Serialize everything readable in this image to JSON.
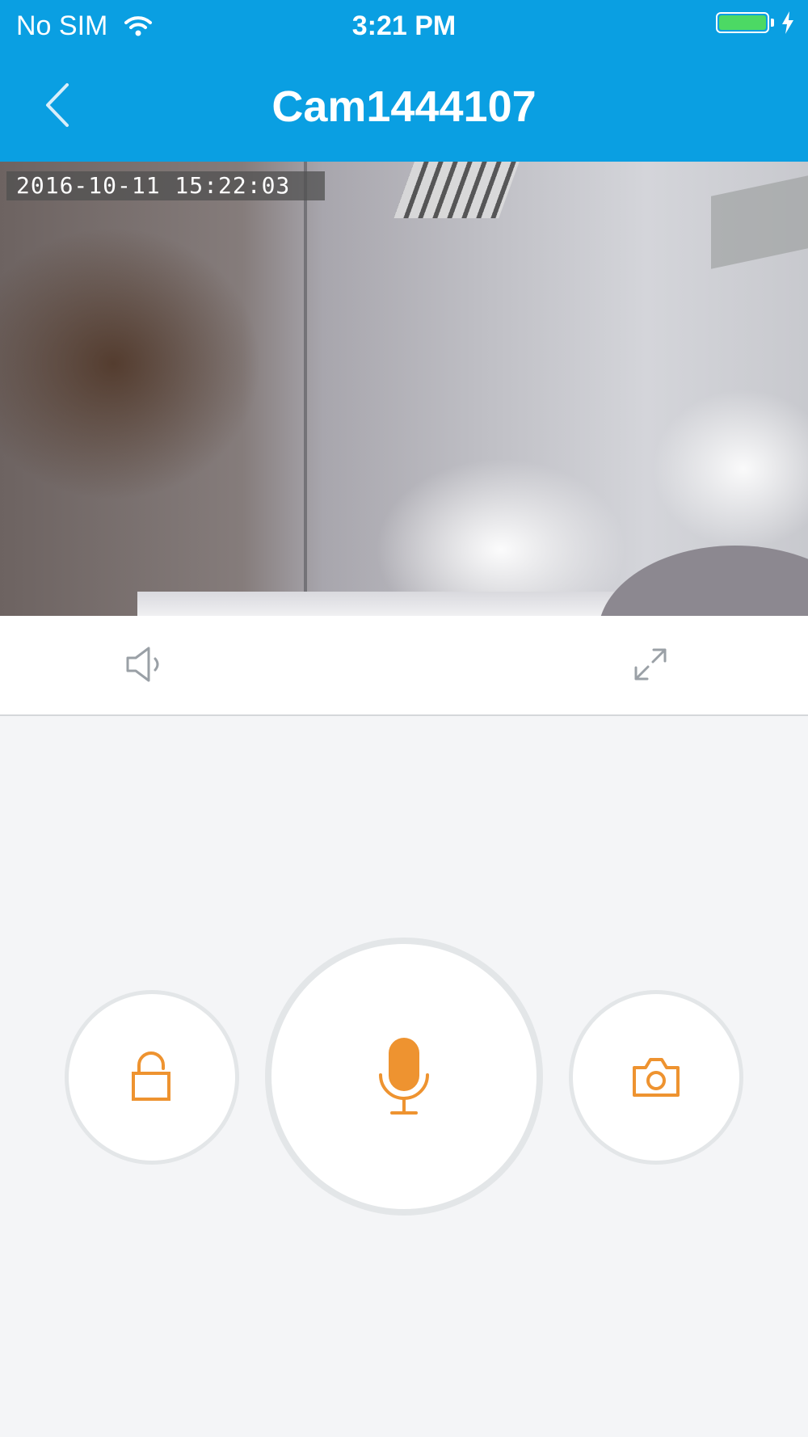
{
  "status_bar": {
    "carrier": "No SIM",
    "time": "3:21 PM",
    "battery_color": "#4cd964"
  },
  "header": {
    "title": "Cam1444107",
    "background_color": "#0a9fe2"
  },
  "video": {
    "timestamp_overlay": "2016-10-11  15:22:03"
  },
  "controls": {
    "speaker_icon": "speaker-icon",
    "fullscreen_icon": "fullscreen-icon"
  },
  "actions": {
    "accent_color": "#ee9330",
    "items": [
      {
        "icon": "unlock-icon"
      },
      {
        "icon": "microphone-icon"
      },
      {
        "icon": "camera-icon"
      }
    ]
  }
}
